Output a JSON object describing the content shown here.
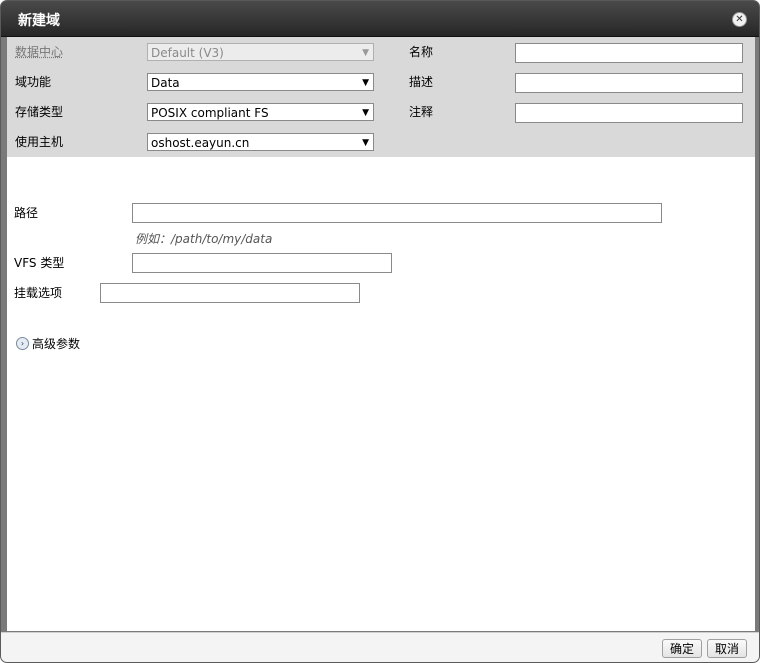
{
  "dialog": {
    "title": "新建域"
  },
  "form": {
    "datacenter": {
      "label": "数据中心",
      "value": "Default (V3)"
    },
    "domain_function": {
      "label": "域功能",
      "value": "Data"
    },
    "storage_type": {
      "label": "存储类型",
      "value": "POSIX compliant FS"
    },
    "use_host": {
      "label": "使用主机",
      "value": "oshost.eayun.cn"
    },
    "name": {
      "label": "名称",
      "value": ""
    },
    "description": {
      "label": "描述",
      "value": ""
    },
    "comment": {
      "label": "注释",
      "value": ""
    }
  },
  "posix": {
    "path_label": "路径",
    "path_value": "",
    "path_hint": "例如：/path/to/my/data",
    "vfs_label": "VFS 类型",
    "vfs_value": "",
    "mount_label": "挂载选项",
    "mount_value": ""
  },
  "advanced": {
    "label": "高级参数"
  },
  "buttons": {
    "ok": "确定",
    "cancel": "取消"
  },
  "icons": {
    "close": "close-circle-icon",
    "expand": "chevron-right-circle-icon"
  }
}
